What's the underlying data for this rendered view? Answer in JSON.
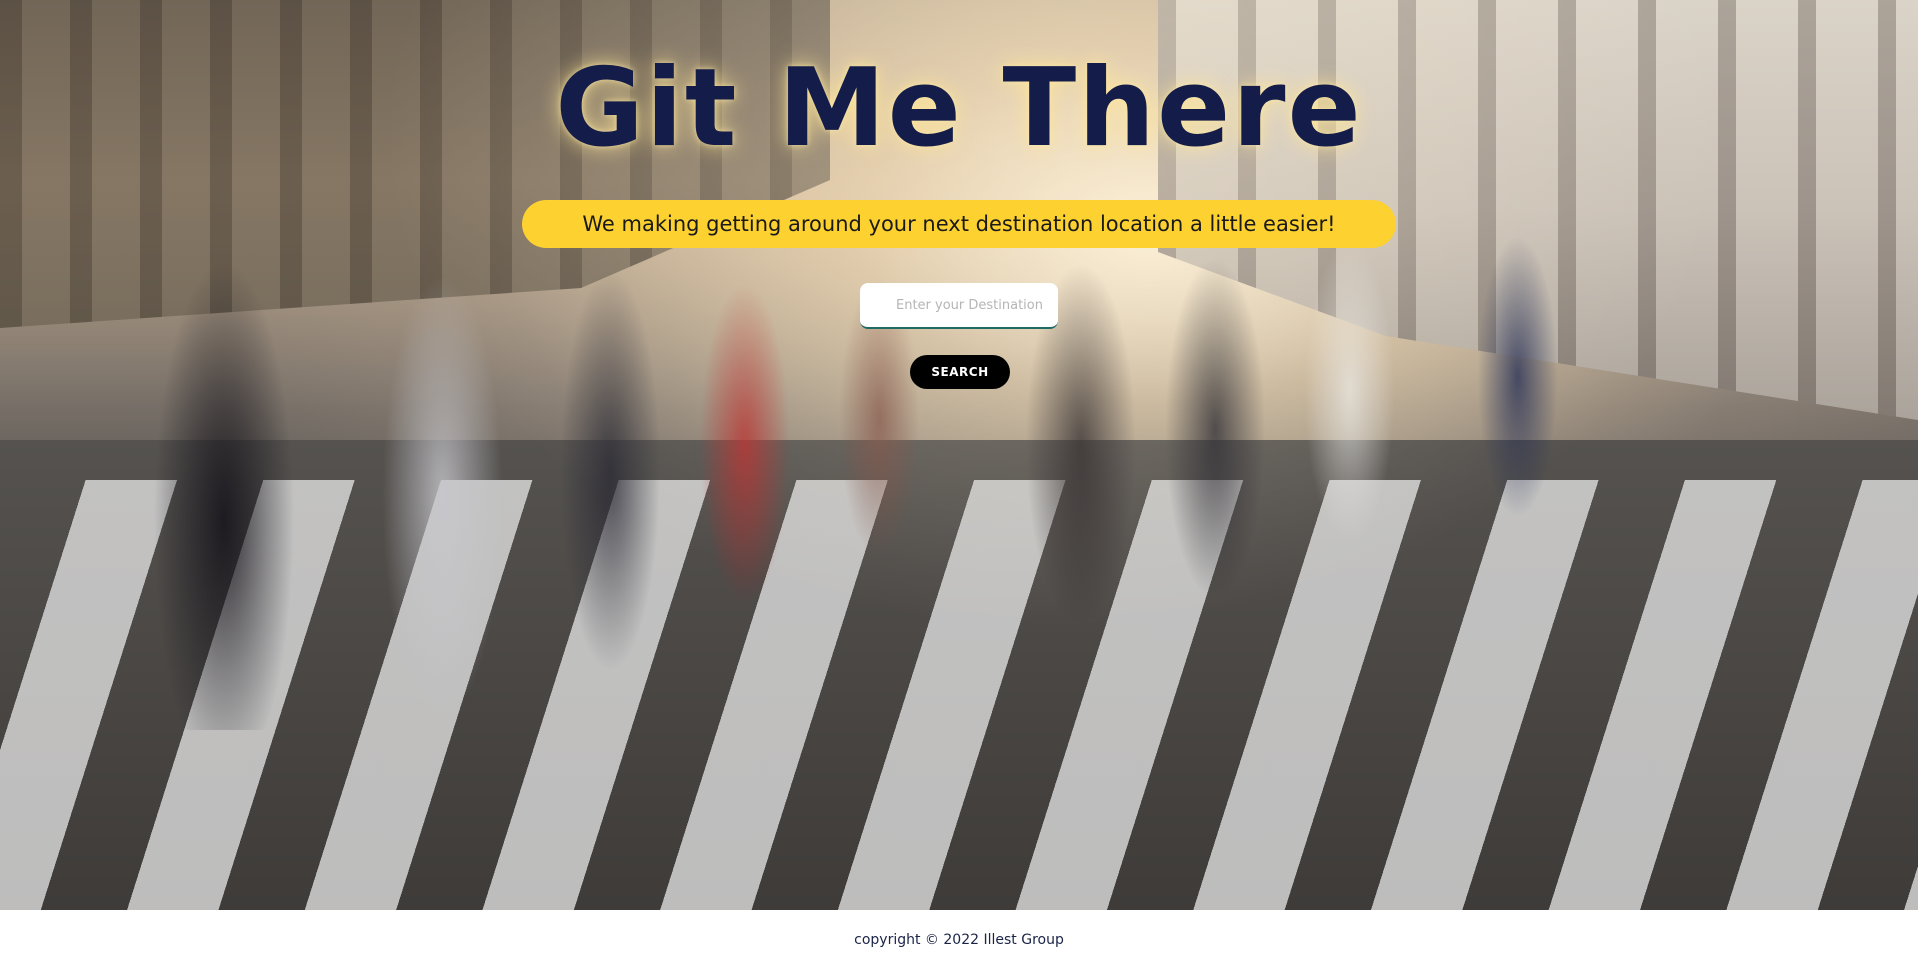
{
  "hero": {
    "title": "Git Me There",
    "tagline": "We making getting around your next destination location a little easier!",
    "background_image": "city-crosswalk-crowd-photo"
  },
  "search": {
    "placeholder": "Enter your Destination",
    "value": "",
    "button_label": "SEARCH"
  },
  "footer": {
    "copyright": "copyright © 2022 Illest Group"
  },
  "colors": {
    "title": "#141d4a",
    "tagline_pill": "#fcd130",
    "search_button": "#000000",
    "input_underline": "#1e6b63"
  }
}
